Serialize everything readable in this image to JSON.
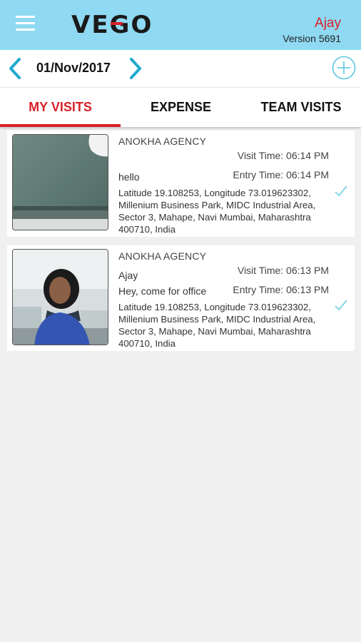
{
  "header": {
    "logo": "VEGO",
    "user_name": "Ajay",
    "version": "Version 5691",
    "brand_color": "#d92128",
    "bar_color": "#8fd9f2"
  },
  "datebar": {
    "date": "01/Nov/2017",
    "prev_icon": "chevron-left-icon",
    "next_icon": "chevron-right-icon",
    "add_icon": "add-circle-icon"
  },
  "tabs": [
    {
      "label": "MY VISITS",
      "active": true
    },
    {
      "label": "EXPENSE",
      "active": false
    },
    {
      "label": "TEAM VISITS",
      "active": false
    }
  ],
  "visits": [
    {
      "agency": "ANOKHA AGENCY",
      "person": "",
      "remark": "hello",
      "visit_time": "Visit Time: 06:14 PM",
      "entry_time": "Entry Time: 06:14 PM",
      "address": "Latitude 19.108253, Longitude 73.019623302, Millenium Business Park, MIDC Industrial Area, Sector 3, Mahape, Navi Mumbai, Maharashtra 400710, India",
      "status_icon": "check-icon"
    },
    {
      "agency": "ANOKHA AGENCY",
      "person": "Ajay",
      "remark": "Hey, come for office",
      "visit_time": "Visit Time: 06:13 PM",
      "entry_time": "Entry Time: 06:13 PM",
      "address": "Latitude 19.108253, Longitude 73.019623302, Millenium Business Park, MIDC Industrial Area, Sector 3, Mahape, Navi Mumbai, Maharashtra 400710, India",
      "status_icon": "check-icon"
    }
  ]
}
